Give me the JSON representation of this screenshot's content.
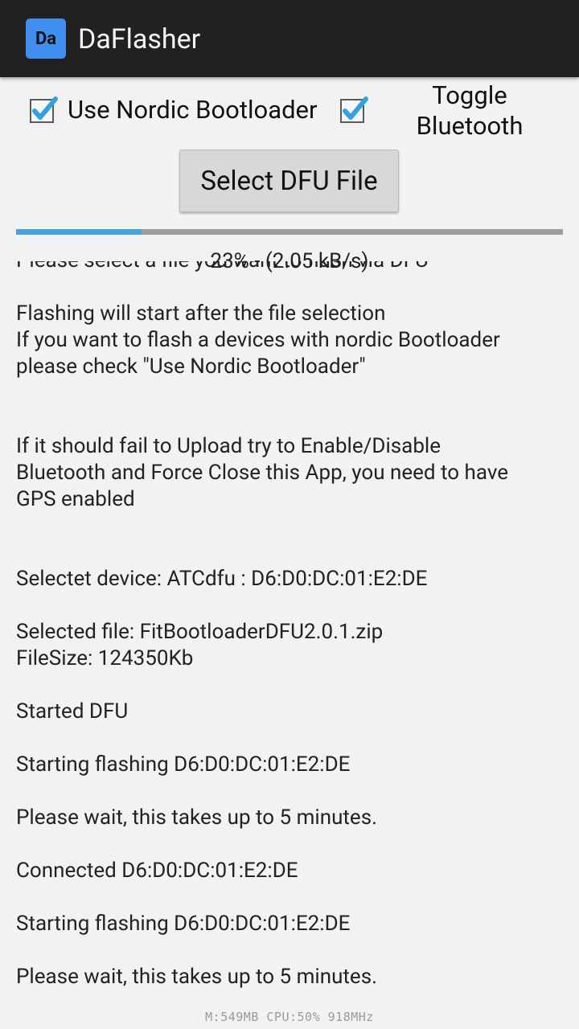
{
  "app": {
    "icon_text": "Da",
    "title": "DaFlasher"
  },
  "options": {
    "nordic_label": "Use Nordic Bootloader",
    "nordic_checked": true,
    "bluetooth_checked": true,
    "toggle_bluetooth_label": "Toggle Bluetooth"
  },
  "select_button_label": "Select DFU File",
  "progress": {
    "percent": 23,
    "text": "23% - (2.05 kB/s)"
  },
  "log": {
    "lines": [
      "Please select a file you want to flash via DFU",
      "",
      "Flashing will start after the file selection",
      "If you want to flash a devices with nordic Bootloader",
      "please check \"Use Nordic Bootloader\"",
      "",
      "",
      "If it should fail to Upload try to Enable/Disable",
      "Bluetooth and Force Close this App, you need to have",
      "GPS enabled",
      "",
      "",
      "Selectet device: ATCdfu : D6:D0:DC:01:E2:DE",
      "",
      "Selected file: FitBootloaderDFU2.0.1.zip",
      "FileSize: 124350Kb",
      "",
      "Started DFU",
      "",
      "Starting flashing D6:D0:DC:01:E2:DE",
      "",
      "Please wait, this takes up to 5 minutes.",
      "",
      "Connected D6:D0:DC:01:E2:DE",
      "",
      "Starting flashing D6:D0:DC:01:E2:DE",
      "",
      "Please wait, this takes up to 5 minutes."
    ]
  },
  "overlay": {
    "text": "M:549MB CPU:50%  918MHz"
  },
  "colors": {
    "actionbar": "#212121",
    "accent": "#4aa3df",
    "icon_bg": "#3f8ef0"
  }
}
